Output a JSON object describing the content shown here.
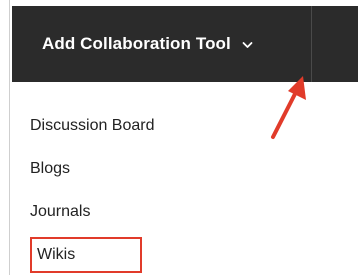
{
  "toolbar": {
    "button_label": "Add Collaboration Tool",
    "chevron_icon": "chevron-down-icon"
  },
  "menu": {
    "items": [
      {
        "label": "Discussion Board"
      },
      {
        "label": "Blogs"
      },
      {
        "label": "Journals"
      },
      {
        "label": "Wikis"
      }
    ]
  },
  "annotations": {
    "arrow_color": "#e13b2a",
    "highlight_color": "#e13b2a"
  },
  "colors": {
    "toolbar_background": "#2b2b2b",
    "toolbar_text": "#ffffff",
    "menu_text": "#222222"
  }
}
